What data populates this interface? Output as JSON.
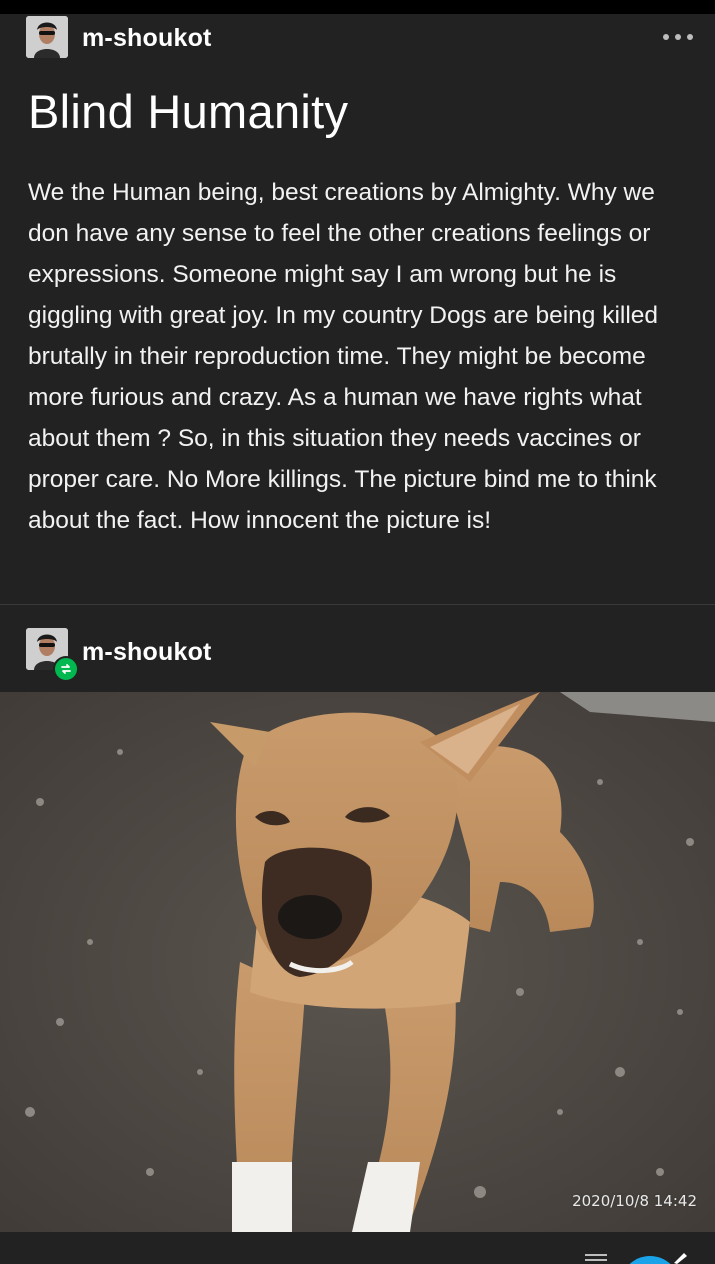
{
  "post": {
    "author": "m-shoukot",
    "avatar_icon": "user-avatar",
    "more_icon": "ellipsis-icon",
    "title": "Blind Humanity",
    "body": "We the Human being, best creations by Almighty. Why we don have any sense to feel the other creations feelings or expressions. Someone might say I am wrong but he is giggling with great joy. In my country Dogs are being killed brutally in their reproduction time. They might be become more furious and crazy. As a human we have rights what about them ? So, in this situation they needs vaccines or proper care. No More killings. The picture bind me to think about the fact. How innocent the picture is!"
  },
  "reblog": {
    "author": "m-shoukot",
    "badge_icon": "reblog-icon",
    "badge_color": "#00b84f"
  },
  "photo": {
    "subject": "dog lying on gravel ground",
    "timestamp": "2020/10/8  14:42"
  },
  "colors": {
    "background": "#222222",
    "text": "#ffffff",
    "accent_blue": "#1aa3e8"
  }
}
